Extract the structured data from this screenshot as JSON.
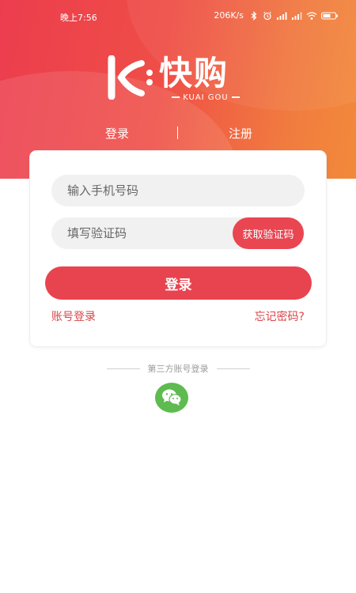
{
  "status_bar": {
    "time": "晚上7:56",
    "network_speed": "206K/s",
    "icons": [
      "bluetooth-icon",
      "alarm-icon",
      "signal-icon",
      "signal-icon",
      "wifi-icon",
      "battery-icon"
    ]
  },
  "brand": {
    "name": "快购",
    "subtitle": "KUAI GOU",
    "color_primary": "#e8444f",
    "color_gradient_end": "#f28a3a"
  },
  "tabs": {
    "login": "登录",
    "register": "注册"
  },
  "form": {
    "phone_placeholder": "输入手机号码",
    "code_placeholder": "填写验证码",
    "get_code_button": "获取验证码",
    "login_button": "登录",
    "account_login_link": "账号登录",
    "forgot_password_link": "忘记密码?"
  },
  "third_party": {
    "label": "第三方账号登录",
    "providers": [
      "wechat-icon"
    ],
    "wechat_color": "#5ebb4f"
  }
}
